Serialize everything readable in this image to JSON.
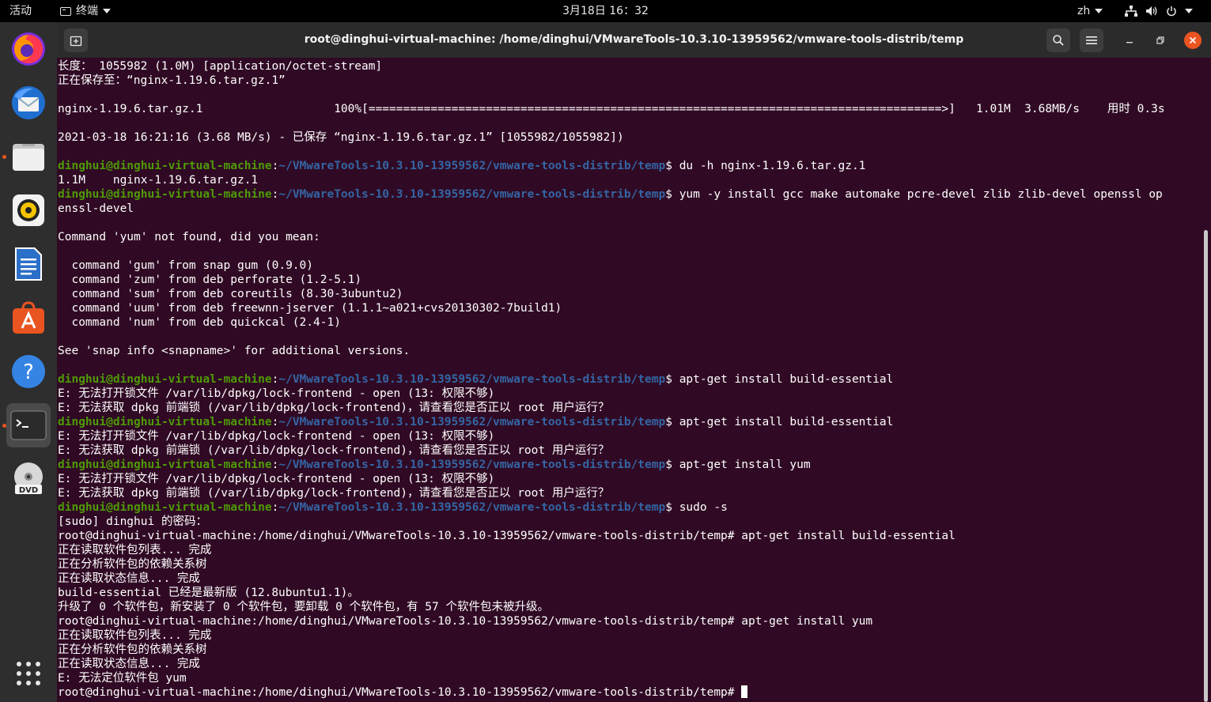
{
  "topbar": {
    "activities": "活动",
    "app_menu": "终端",
    "clock": "3月18日 16：32",
    "lang": "zh"
  },
  "dock": {
    "apps": [
      "firefox",
      "thunderbird",
      "files",
      "rhythmbox",
      "libreoffice-writer",
      "ubuntu-software",
      "help",
      "terminal",
      "dvd"
    ],
    "show_apps": "show-applications"
  },
  "window": {
    "title": "root@dinghui-virtual-machine: /home/dinghui/VMwareTools-10.3.10-13959562/vmware-tools-distrib/temp"
  },
  "terminal": {
    "user_prompt": "dinghui@dinghui-virtual-machine",
    "path": "~/VMwareTools-10.3.10-13959562/vmware-tools-distrib/temp",
    "root_prompt": "root@dinghui-virtual-machine:/home/dinghui/VMwareTools-10.3.10-13959562/vmware-tools-distrib/temp# ",
    "lines": [
      {
        "t": "text",
        "s": "长度： 1055982 (1.0M) [application/octet-stream]"
      },
      {
        "t": "text",
        "s": "正在保存至：“nginx-1.19.6.tar.gz.1”"
      },
      {
        "t": "text",
        "s": ""
      },
      {
        "t": "text",
        "s": "nginx-1.19.6.tar.gz.1                   100%[===================================================================================>]   1.01M  3.68MB/s    用时 0.3s"
      },
      {
        "t": "text",
        "s": ""
      },
      {
        "t": "text",
        "s": "2021-03-18 16:21:16 (3.68 MB/s) - 已保存 “nginx-1.19.6.tar.gz.1” [1055982/1055982])"
      },
      {
        "t": "text",
        "s": ""
      },
      {
        "t": "user",
        "s": "du -h nginx-1.19.6.tar.gz.1"
      },
      {
        "t": "text",
        "s": "1.1M    nginx-1.19.6.tar.gz.1"
      },
      {
        "t": "user",
        "s": "yum -y install gcc make automake pcre-devel zlib zlib-devel openssl op"
      },
      {
        "t": "text",
        "s": "enssl-devel"
      },
      {
        "t": "text",
        "s": ""
      },
      {
        "t": "text",
        "s": "Command 'yum' not found, did you mean:"
      },
      {
        "t": "text",
        "s": ""
      },
      {
        "t": "text",
        "s": "  command 'gum' from snap gum (0.9.0)"
      },
      {
        "t": "text",
        "s": "  command 'zum' from deb perforate (1.2-5.1)"
      },
      {
        "t": "text",
        "s": "  command 'sum' from deb coreutils (8.30-3ubuntu2)"
      },
      {
        "t": "text",
        "s": "  command 'uum' from deb freewnn-jserver (1.1.1~a021+cvs20130302-7build1)"
      },
      {
        "t": "text",
        "s": "  command 'num' from deb quickcal (2.4-1)"
      },
      {
        "t": "text",
        "s": ""
      },
      {
        "t": "text",
        "s": "See 'snap info <snapname>' for additional versions."
      },
      {
        "t": "text",
        "s": ""
      },
      {
        "t": "user",
        "s": "apt-get install build-essential"
      },
      {
        "t": "text",
        "s": "E: 无法打开锁文件 /var/lib/dpkg/lock-frontend - open (13: 权限不够)"
      },
      {
        "t": "text",
        "s": "E: 无法获取 dpkg 前端锁 (/var/lib/dpkg/lock-frontend)，请查看您是否正以 root 用户运行？"
      },
      {
        "t": "user",
        "s": "apt-get install build-essential"
      },
      {
        "t": "text",
        "s": "E: 无法打开锁文件 /var/lib/dpkg/lock-frontend - open (13: 权限不够)"
      },
      {
        "t": "text",
        "s": "E: 无法获取 dpkg 前端锁 (/var/lib/dpkg/lock-frontend)，请查看您是否正以 root 用户运行？"
      },
      {
        "t": "user",
        "s": "apt-get install yum"
      },
      {
        "t": "text",
        "s": "E: 无法打开锁文件 /var/lib/dpkg/lock-frontend - open (13: 权限不够)"
      },
      {
        "t": "text",
        "s": "E: 无法获取 dpkg 前端锁 (/var/lib/dpkg/lock-frontend)，请查看您是否正以 root 用户运行？"
      },
      {
        "t": "user",
        "s": "sudo -s"
      },
      {
        "t": "text",
        "s": "[sudo] dinghui 的密码："
      },
      {
        "t": "root",
        "s": "apt-get install build-essential"
      },
      {
        "t": "text",
        "s": "正在读取软件包列表... 完成"
      },
      {
        "t": "text",
        "s": "正在分析软件包的依赖关系树"
      },
      {
        "t": "text",
        "s": "正在读取状态信息... 完成"
      },
      {
        "t": "text",
        "s": "build-essential 已经是最新版 (12.8ubuntu1.1)。"
      },
      {
        "t": "text",
        "s": "升级了 0 个软件包，新安装了 0 个软件包，要卸载 0 个软件包，有 57 个软件包未被升级。"
      },
      {
        "t": "root",
        "s": "apt-get install yum"
      },
      {
        "t": "text",
        "s": "正在读取软件包列表... 完成"
      },
      {
        "t": "text",
        "s": "正在分析软件包的依赖关系树"
      },
      {
        "t": "text",
        "s": "正在读取状态信息... 完成"
      },
      {
        "t": "text",
        "s": "E: 无法定位软件包 yum"
      },
      {
        "t": "rootcursor",
        "s": ""
      }
    ]
  },
  "colors": {
    "terminal_bg": "#300a24",
    "prompt_user": "#4e9a06",
    "prompt_path": "#3465a4",
    "accent": "#e95420"
  }
}
